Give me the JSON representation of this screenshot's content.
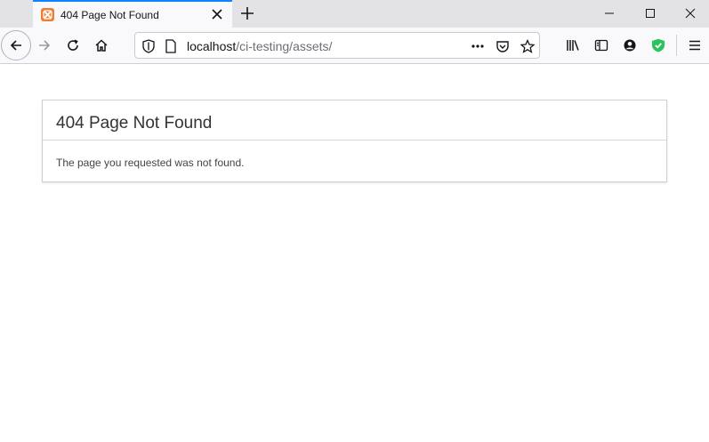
{
  "tab": {
    "title": "404 Page Not Found",
    "favicon": "xampp-icon"
  },
  "address_bar": {
    "host": "localhost",
    "path": "/ci-testing/assets/"
  },
  "page": {
    "heading": "404 Page Not Found",
    "message": "The page you requested was not found."
  },
  "colors": {
    "accent": "#0a84ff",
    "favicon": "#f07d32",
    "shield_green": "#2ac35d"
  }
}
